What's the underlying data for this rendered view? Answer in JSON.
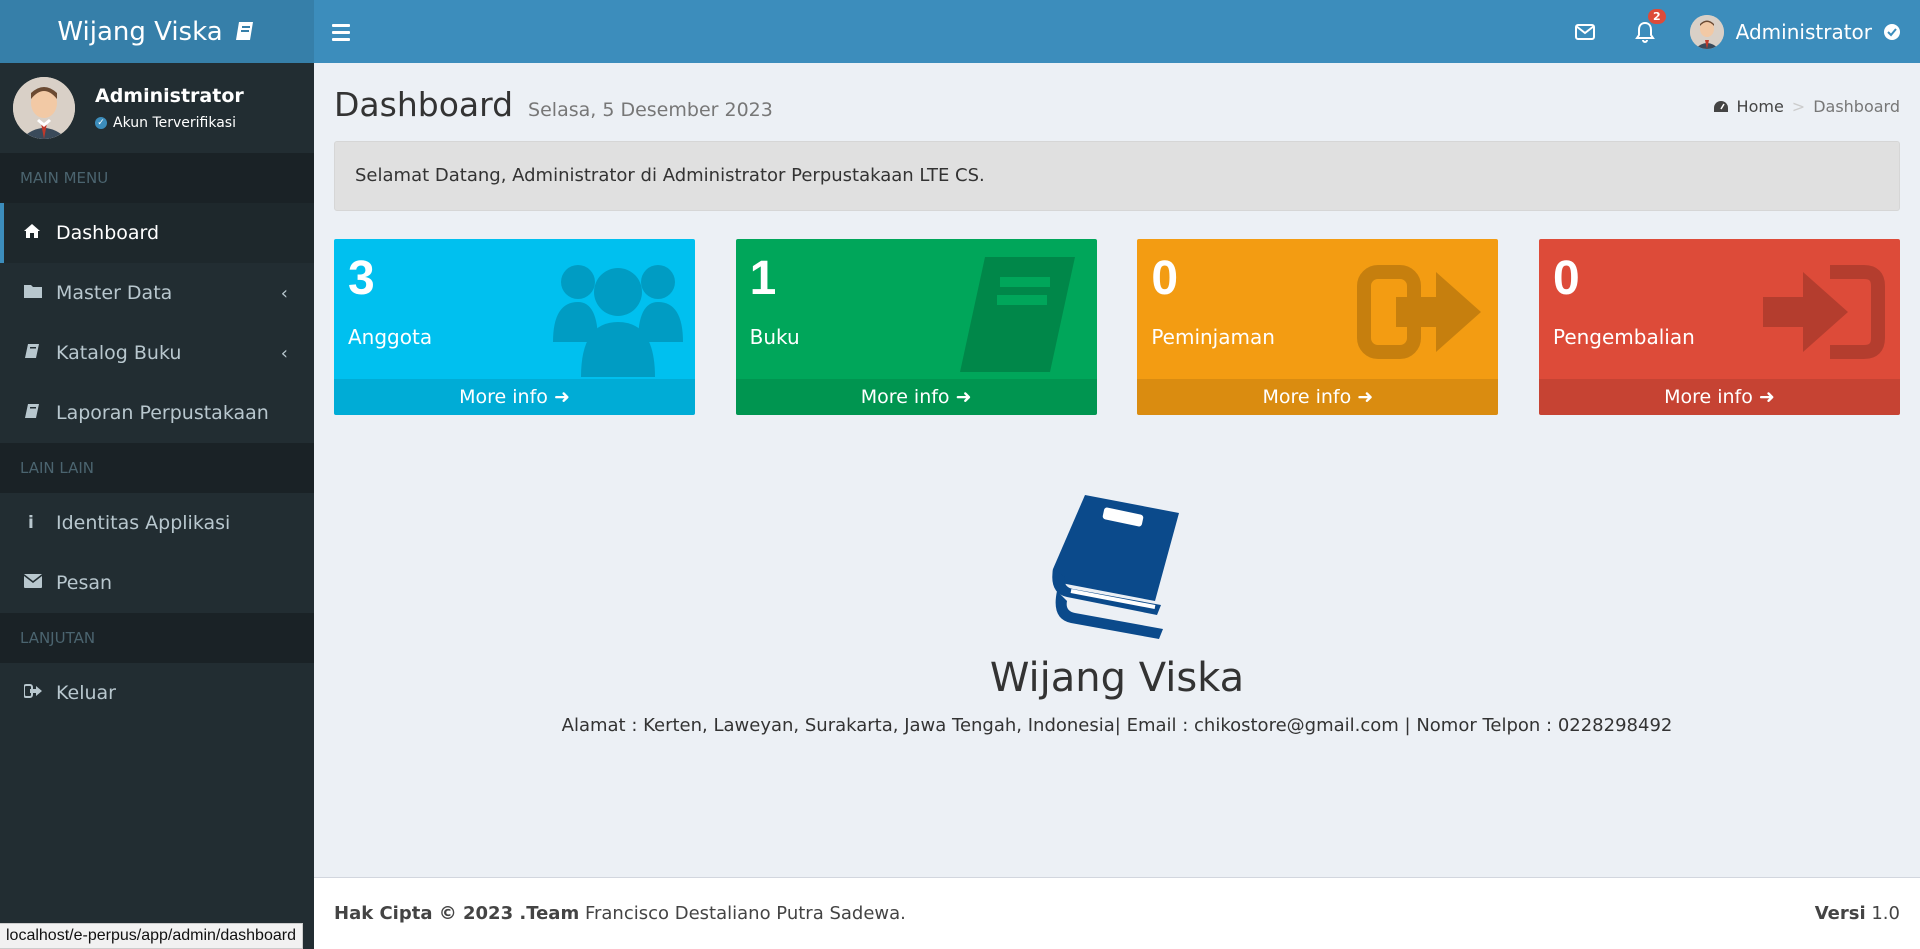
{
  "app": {
    "brand": "Wijang Viska",
    "colors": {
      "header": "#3c8dbc",
      "logo": "#367fa9",
      "sidebar": "#222d32"
    }
  },
  "navbar": {
    "notification_count": "2",
    "user_name": "Administrator"
  },
  "sidebar": {
    "user_name": "Administrator",
    "user_status": "Akun Terverifikasi",
    "sections": {
      "main": "MAIN MENU",
      "other": "LAIN LAIN",
      "next": "LANJUTAN"
    },
    "items": [
      {
        "label": "Dashboard",
        "icon": "home-icon"
      },
      {
        "label": "Master Data",
        "icon": "folder-icon"
      },
      {
        "label": "Katalog Buku",
        "icon": "book-icon"
      },
      {
        "label": "Laporan Perpustakaan",
        "icon": "book-icon"
      },
      {
        "label": "Identitas Applikasi",
        "icon": "info-icon"
      },
      {
        "label": "Pesan",
        "icon": "envelope-icon"
      },
      {
        "label": "Keluar",
        "icon": "sign-out-icon"
      }
    ]
  },
  "page": {
    "title": "Dashboard",
    "date": "Selasa, 5 Desember 2023",
    "breadcrumb": {
      "home": "Home",
      "current": "Dashboard"
    },
    "welcome": "Selamat Datang, Administrator di Administrator Perpustakaan LTE CS."
  },
  "stats": [
    {
      "value": "3",
      "label": "Anggota",
      "more": "More info",
      "color": "#00c0ef",
      "icon": "users-icon"
    },
    {
      "value": "1",
      "label": "Buku",
      "more": "More info",
      "color": "#00a65a",
      "icon": "book-icon"
    },
    {
      "value": "0",
      "label": "Peminjaman",
      "more": "More info",
      "color": "#f39c12",
      "icon": "sign-out-icon"
    },
    {
      "value": "0",
      "label": "Pengembalian",
      "more": "More info",
      "color": "#dd4b39",
      "icon": "sign-in-icon"
    }
  ],
  "center": {
    "title": "Wijang Viska",
    "address": "Alamat : Kerten, Laweyan, Surakarta, Jawa Tengah, Indonesia| Email : chikostore@gmail.com | Nomor Telpon : 0228298492"
  },
  "footer": {
    "copyright": "Hak Cipta © 2023 .Team",
    "team": "Francisco Destaliano Putra Sadewa.",
    "version_label": "Versi",
    "version": "1.0"
  },
  "status_url": "localhost/e-perpus/app/admin/dashboard"
}
